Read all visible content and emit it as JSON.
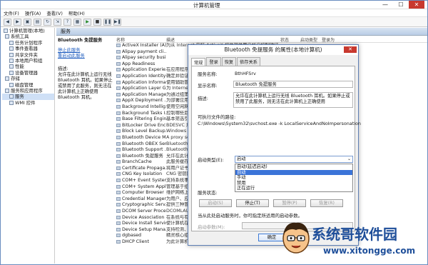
{
  "window": {
    "title": "计算机管理",
    "controls": [
      "—",
      "☐",
      "✕"
    ]
  },
  "menu": [
    "文件(F)",
    "操作(A)",
    "查看(V)",
    "帮助(H)"
  ],
  "tree": [
    "计算机管理(本地)",
    "系统工具",
    "任务计划程序",
    "事件查看器",
    "共享文件夹",
    "本地用户和组",
    "性能",
    "设备管理器",
    "存储",
    "磁盘管理",
    "服务和应用程序",
    "服务",
    "WMI 控件"
  ],
  "services_header": "服务",
  "detail": {
    "service_name": "Bluetooth 免提服务",
    "stop_link": "停止此服务",
    "restart_link": "重启动此服务",
    "desc_label": "描述:",
    "desc_text": "允许在此计算机上运行无线 Bluetooth 耳机。如果停止或禁用了此服务，则无法在此计算机上正确使用 Bluetooth 耳机。"
  },
  "columns": [
    "名称",
    "描述",
    "状态",
    "启动类型",
    "登录为"
  ],
  "rows": [
    {
      "name": "ActiveX Installer (A)",
      "desc": "为从 Internet 安装 ActiveX 控件提供用户帐户控制验证，并基于组策略设置对 ActiveX"
    },
    {
      "name": "Alipay payment cli..",
      "desc": ""
    },
    {
      "name": "Alipay security busi..",
      "desc": ""
    },
    {
      "name": "App Readiness",
      "desc": ""
    },
    {
      "name": "Application Experie..",
      "desc": "在应用程序启"
    },
    {
      "name": "Application Identity",
      "desc": "确定并验证应"
    },
    {
      "name": "Application Informa..",
      "desc": "使用辅助管理"
    },
    {
      "name": "Application Layer G..",
      "desc": "为 Internet"
    },
    {
      "name": "Application Manage..",
      "desc": "为通过组策略"
    },
    {
      "name": "AppX Deployment ...",
      "desc": "为部署应用商"
    },
    {
      "name": "Background Intellig..",
      "desc": "使用空闲网络"
    },
    {
      "name": "Background Tasks I..",
      "desc": "控制哪些后台"
    },
    {
      "name": "Base Filtering Engine",
      "desc": "基本筛选引擎"
    },
    {
      "name": "BitLocker Drive Enc..",
      "desc": "BDESVC 承载"
    },
    {
      "name": "Block Level Backup..",
      "desc": "Windows 备"
    },
    {
      "name": "Bluetooth Device M..",
      "desc": "A proxy ser"
    },
    {
      "name": "Bluetooth OBEX Ser..",
      "desc": "Bluetooth"
    },
    {
      "name": "Bluetooth Support ..",
      "desc": "Bluetooth"
    },
    {
      "name": "Bluetooth 免提服务",
      "desc": "允许在此计算"
    },
    {
      "name": "BranchCache",
      "desc": "此服务缓存来"
    },
    {
      "name": "Certificate Propaga..",
      "desc": "将用户证书和"
    },
    {
      "name": "CNG Key Isolation",
      "desc": "CNG 密钥隔"
    },
    {
      "name": "COM+ Event System",
      "desc": "支持系统事件"
    },
    {
      "name": "COM+ System Appli..",
      "desc": "管理基于组件"
    },
    {
      "name": "Computer Browser",
      "desc": "维护网络上计"
    },
    {
      "name": "Credential Manager",
      "desc": "为用户、应用"
    },
    {
      "name": "Cryptographic Serv..",
      "desc": "提供三种管理"
    },
    {
      "name": "DCOM Server Proce..",
      "desc": "DCOMLAUN"
    },
    {
      "name": "Device Association ..",
      "desc": "在系统与有线"
    },
    {
      "name": "Device Install Service",
      "desc": "使计算机在极"
    },
    {
      "name": "Device Setup Mana..",
      "desc": "支持检测、下载和安装与设备相关的软件。如果禁用此服务，则设备可能被配置为过期软件"
    },
    {
      "name": "dgbased",
      "desc": "精灵核心组件服务，包括程序兼容性检查，服务外限制功能"
    },
    {
      "name": "DHCP Client",
      "desc": "为此计算机注册并更新 IP 地址。如果此服务停止，计算机将不能接收动态 IP 地址和 DNS"
    }
  ],
  "dialog": {
    "title": "Bluetooth 免提服务 的属性(本地计算机)",
    "tabs": [
      "常规",
      "登录",
      "恢复",
      "依存关系"
    ],
    "service_name_label": "服务名称:",
    "service_name_value": "BthHFSrv",
    "display_name_label": "显示名称:",
    "display_name_value": "Bluetooth 免提服务",
    "desc_label": "描述:",
    "desc_value": "允许在此计算机上运行无线 Bluetooth 耳机。如果停止或禁用了此服务，则无法在此计算机上正确使用",
    "path_label": "可执行文件的路径:",
    "path_value": "C:\\Windows\\System32\\svchost.exe -k LocalServiceAndNoImpersonation",
    "startup_label": "启动类型(E):",
    "startup_value": "启动",
    "startup_options": [
      "自动(延迟启动)",
      "自动",
      "手动",
      "禁用",
      "正在运行"
    ],
    "status_label": "服务状态:",
    "status_value": "正在运行",
    "start_btn": "启动(S)",
    "stop_btn": "停止(T)",
    "pause_btn": "暂停(P)",
    "resume_btn": "恢复(R)",
    "hint": "当从此处启动服务时，你可指定所适用的启动参数。",
    "params_label": "启动参数(M):",
    "ok_btn": "确定"
  },
  "watermark": {
    "title": "系统哥软件园",
    "url": "www.xitongge.com"
  }
}
